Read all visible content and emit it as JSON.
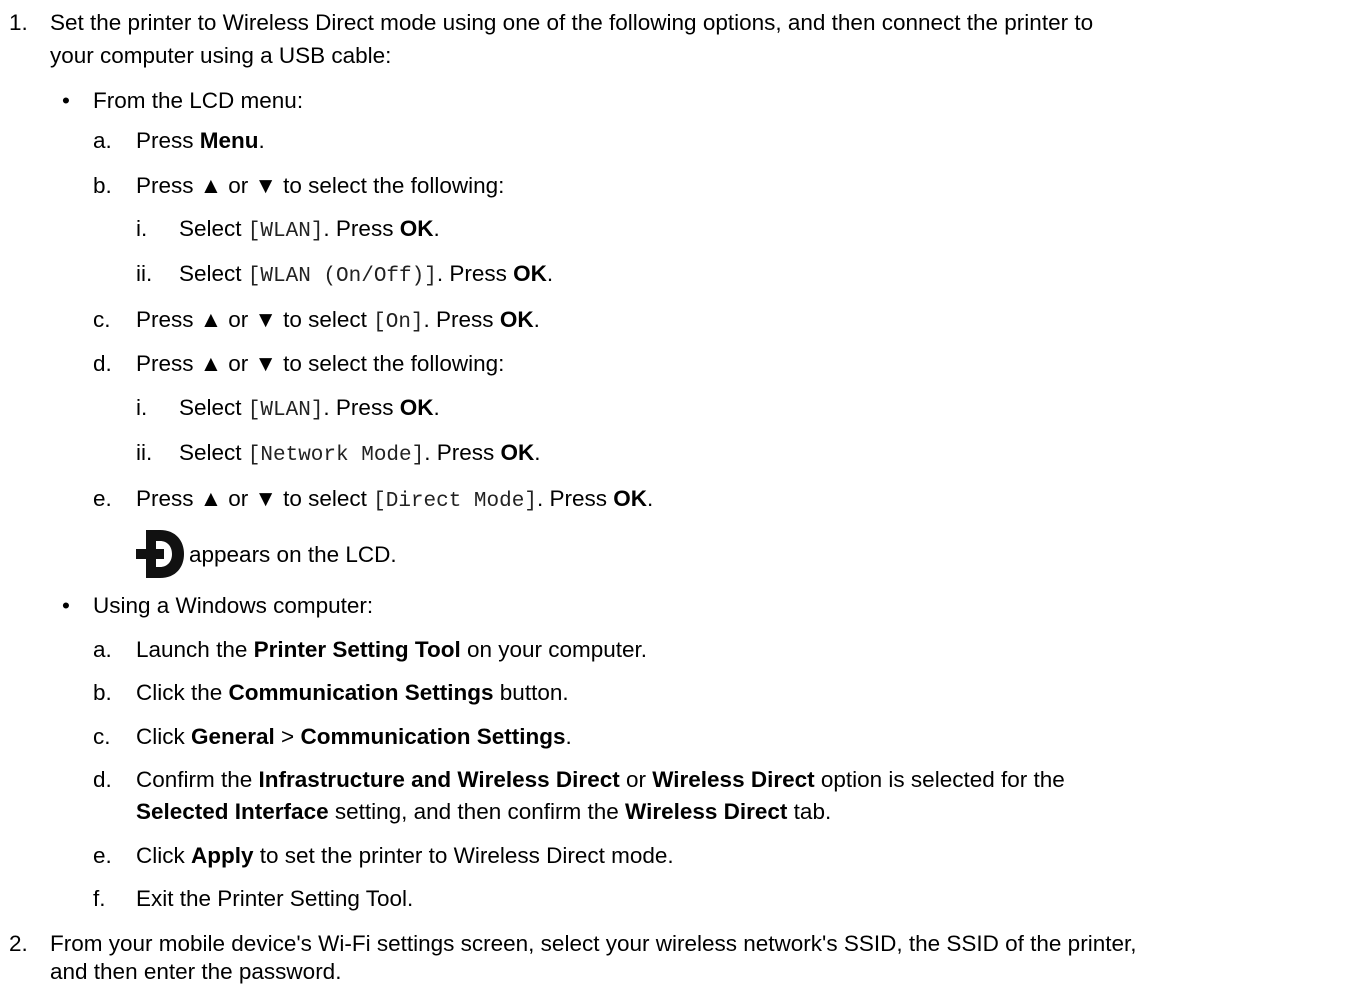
{
  "step1": {
    "num": "1.",
    "line1": "Set the printer to Wireless Direct mode using one of the following options, and then connect the printer to",
    "line2": "your computer using a USB cable:"
  },
  "lcd": {
    "bullet": "•",
    "heading": "From the LCD menu:",
    "a": {
      "marker": "a.",
      "pre": "Press ",
      "b1": "Menu",
      "post": "."
    },
    "b": {
      "marker": "b.",
      "text": "Press ▲ or ▼ to select the following:"
    },
    "b_i": {
      "marker": "i.",
      "pre": "Select ",
      "code": "[WLAN]",
      "mid": ". Press ",
      "b1": "OK",
      "post": "."
    },
    "b_ii": {
      "marker": "ii.",
      "pre": "Select ",
      "code": "[WLAN (On/Off)]",
      "mid": ". Press ",
      "b1": "OK",
      "post": "."
    },
    "c": {
      "marker": "c.",
      "pre": "Press ▲ or ▼ to select ",
      "code": "[On]",
      "mid": ". Press ",
      "b1": "OK",
      "post": "."
    },
    "d": {
      "marker": "d.",
      "text": "Press ▲ or ▼ to select the following:"
    },
    "d_i": {
      "marker": "i.",
      "pre": "Select ",
      "code": "[WLAN]",
      "mid": ". Press ",
      "b1": "OK",
      "post": "."
    },
    "d_ii": {
      "marker": "ii.",
      "pre": "Select ",
      "code": "[Network Mode]",
      "mid": ". Press ",
      "b1": "OK",
      "post": "."
    },
    "e": {
      "marker": "e.",
      "pre": "Press ▲ or ▼ to select ",
      "code": "[Direct Mode]",
      "mid": ". Press ",
      "b1": "OK",
      "post": "."
    },
    "icon_note": "appears on the LCD."
  },
  "win": {
    "bullet": "•",
    "heading": "Using a Windows computer:",
    "a": {
      "marker": "a.",
      "pre": "Launch the ",
      "b1": "Printer Setting Tool",
      "post": " on your computer."
    },
    "b": {
      "marker": "b.",
      "pre": "Click the ",
      "b1": "Communication Settings",
      "post": " button."
    },
    "c": {
      "marker": "c.",
      "pre": "Click ",
      "b1": "General",
      "mid": " > ",
      "b2": "Communication Settings",
      "post": "."
    },
    "d": {
      "marker": "d.",
      "pre": "Confirm the ",
      "b1": "Infrastructure and Wireless Direct",
      "mid1": " or ",
      "b2": "Wireless Direct",
      "post1": " option is selected for the",
      "b3": "Selected Interface",
      "mid2": " setting, and then confirm the ",
      "b4": "Wireless Direct",
      "post2": " tab."
    },
    "e": {
      "marker": "e.",
      "pre": "Click ",
      "b1": "Apply",
      "post": " to set the printer to Wireless Direct mode."
    },
    "f": {
      "marker": "f.",
      "text": "Exit the Printer Setting Tool."
    }
  },
  "step2": {
    "num": "2.",
    "line1": "From your mobile device's Wi-Fi settings screen, select your wireless network's SSID, the SSID of the printer,",
    "line2": "and then enter the password."
  },
  "icons": {
    "direct_mode": "wireless-direct-mode-icon"
  },
  "colors": {
    "text": "#000000",
    "code": "#222222",
    "background": "#ffffff"
  }
}
